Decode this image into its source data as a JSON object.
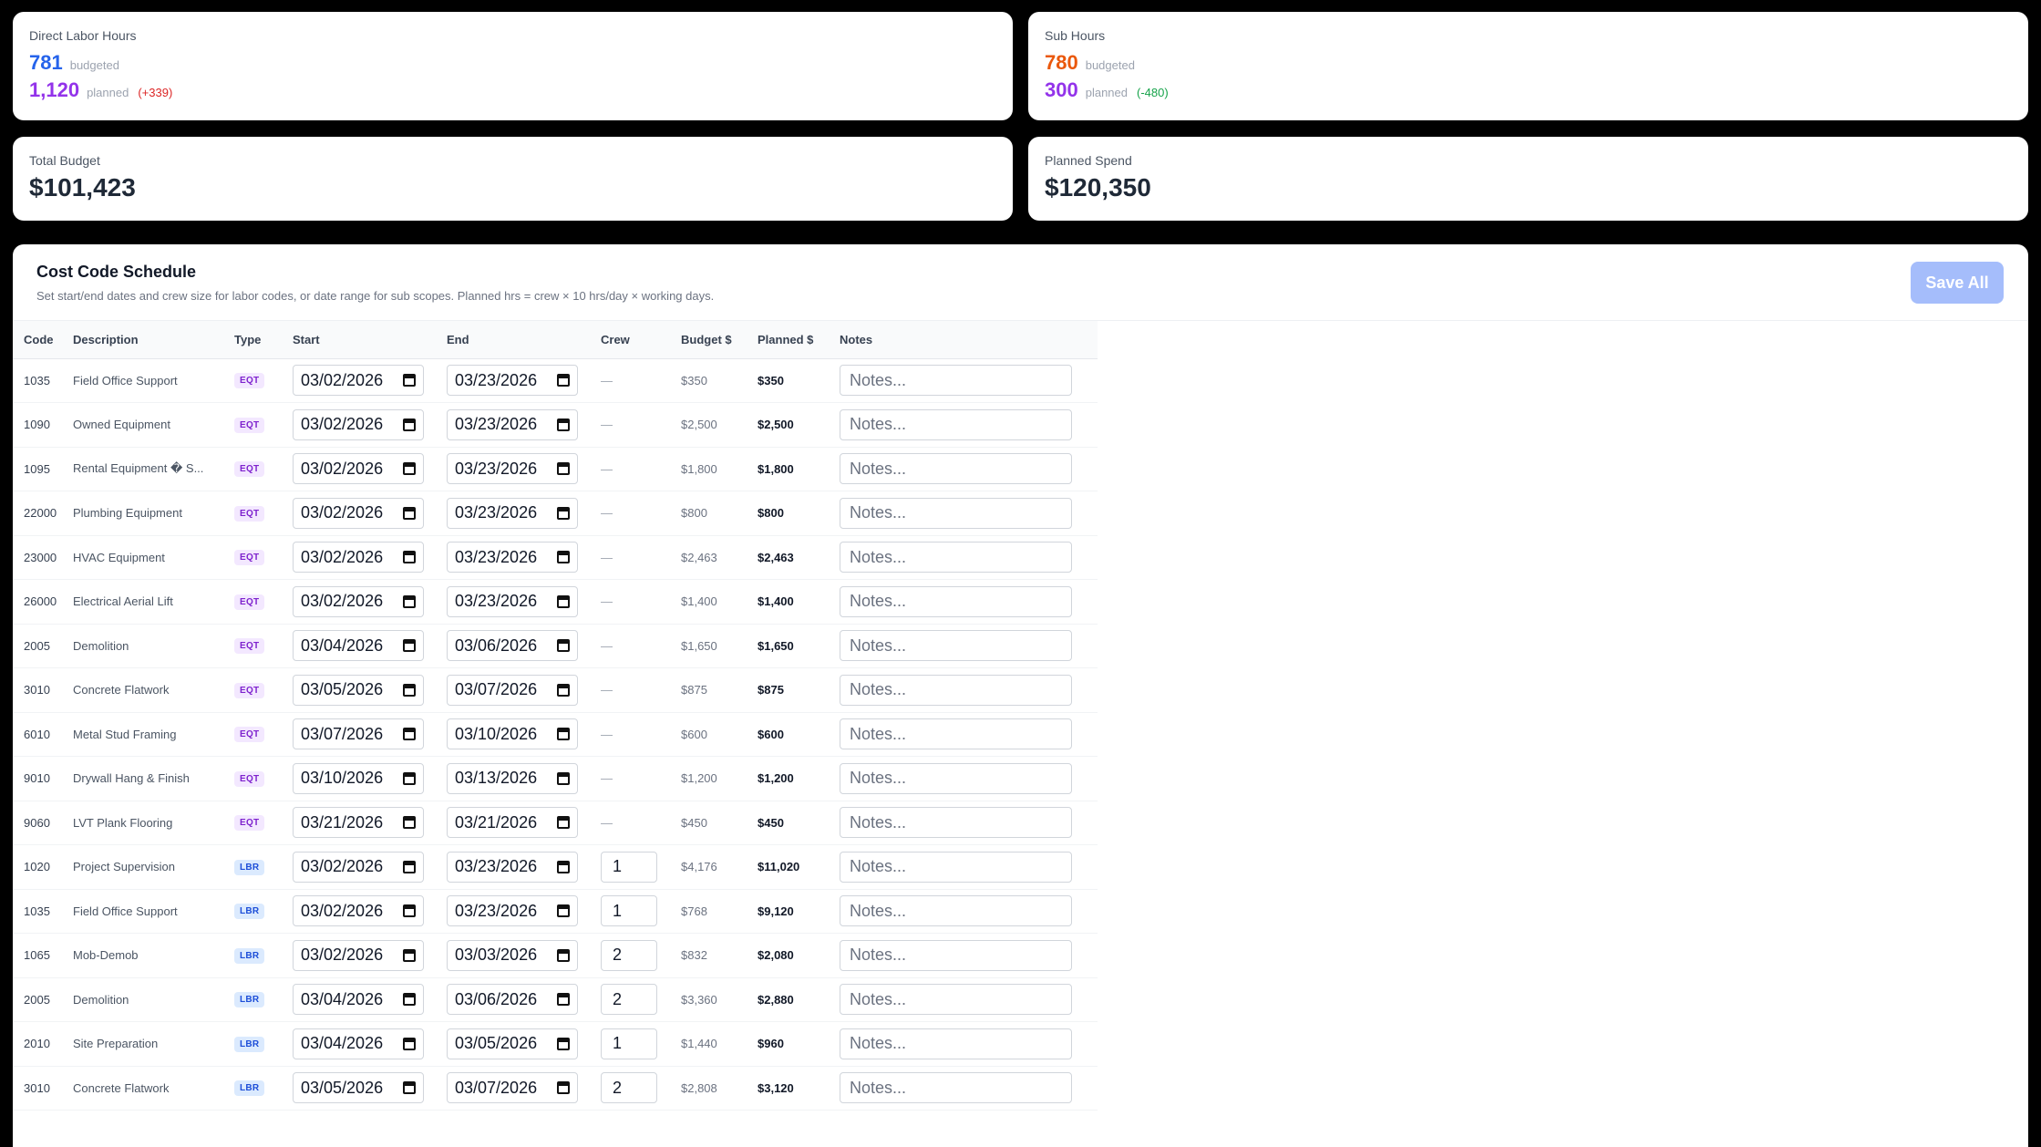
{
  "cards": {
    "labor": {
      "label": "Direct Labor Hours",
      "budgeted_value": "781",
      "budgeted_label": "budgeted",
      "planned_value": "1,120",
      "planned_label": "planned",
      "delta": "(+339)",
      "colors": {
        "budgeted": "#2563eb",
        "planned": "#9333ea",
        "delta": "#dc2626"
      }
    },
    "sub": {
      "label": "Sub Hours",
      "budgeted_value": "780",
      "budgeted_label": "budgeted",
      "planned_value": "300",
      "planned_label": "planned",
      "delta": "(-480)",
      "colors": {
        "budgeted": "#ea580c",
        "planned": "#9333ea",
        "delta": "#16a34a"
      }
    },
    "total_budget": {
      "label": "Total Budget",
      "value": "$101,423"
    },
    "planned_spend": {
      "label": "Planned Spend",
      "value": "$120,350"
    }
  },
  "schedule": {
    "title": "Cost Code Schedule",
    "subtitle": "Set start/end dates and crew size for labor codes, or date range for sub scopes. Planned hrs = crew × 10 hrs/day × working days.",
    "save_label": "Save All",
    "notes_placeholder": "Notes...",
    "columns": [
      "Code",
      "Description",
      "Type",
      "Start",
      "End",
      "Crew",
      "Budget $",
      "Planned $",
      "Notes"
    ],
    "rows": [
      {
        "code": "1035",
        "desc": "Field Office Support",
        "type": "EQT",
        "start": "03/02/2026",
        "end": "03/23/2026",
        "crew": "—",
        "budget": "$350",
        "planned": "$350"
      },
      {
        "code": "1090",
        "desc": "Owned Equipment",
        "type": "EQT",
        "start": "03/02/2026",
        "end": "03/23/2026",
        "crew": "—",
        "budget": "$2,500",
        "planned": "$2,500"
      },
      {
        "code": "1095",
        "desc": "Rental Equipment � S...",
        "type": "EQT",
        "start": "03/02/2026",
        "end": "03/23/2026",
        "crew": "—",
        "budget": "$1,800",
        "planned": "$1,800"
      },
      {
        "code": "22000",
        "desc": "Plumbing Equipment",
        "type": "EQT",
        "start": "03/02/2026",
        "end": "03/23/2026",
        "crew": "—",
        "budget": "$800",
        "planned": "$800"
      },
      {
        "code": "23000",
        "desc": "HVAC Equipment",
        "type": "EQT",
        "start": "03/02/2026",
        "end": "03/23/2026",
        "crew": "—",
        "budget": "$2,463",
        "planned": "$2,463"
      },
      {
        "code": "26000",
        "desc": "Electrical Aerial Lift",
        "type": "EQT",
        "start": "03/02/2026",
        "end": "03/23/2026",
        "crew": "—",
        "budget": "$1,400",
        "planned": "$1,400"
      },
      {
        "code": "2005",
        "desc": "Demolition",
        "type": "EQT",
        "start": "03/04/2026",
        "end": "03/06/2026",
        "crew": "—",
        "budget": "$1,650",
        "planned": "$1,650"
      },
      {
        "code": "3010",
        "desc": "Concrete Flatwork",
        "type": "EQT",
        "start": "03/05/2026",
        "end": "03/07/2026",
        "crew": "—",
        "budget": "$875",
        "planned": "$875"
      },
      {
        "code": "6010",
        "desc": "Metal Stud Framing",
        "type": "EQT",
        "start": "03/07/2026",
        "end": "03/10/2026",
        "crew": "—",
        "budget": "$600",
        "planned": "$600"
      },
      {
        "code": "9010",
        "desc": "Drywall Hang & Finish",
        "type": "EQT",
        "start": "03/10/2026",
        "end": "03/13/2026",
        "crew": "—",
        "budget": "$1,200",
        "planned": "$1,200"
      },
      {
        "code": "9060",
        "desc": "LVT Plank Flooring",
        "type": "EQT",
        "start": "03/21/2026",
        "end": "03/21/2026",
        "crew": "—",
        "budget": "$450",
        "planned": "$450"
      },
      {
        "code": "1020",
        "desc": "Project Supervision",
        "type": "LBR",
        "start": "03/02/2026",
        "end": "03/23/2026",
        "crew": "1",
        "budget": "$4,176",
        "planned": "$11,020"
      },
      {
        "code": "1035",
        "desc": "Field Office Support",
        "type": "LBR",
        "start": "03/02/2026",
        "end": "03/23/2026",
        "crew": "1",
        "budget": "$768",
        "planned": "$9,120"
      },
      {
        "code": "1065",
        "desc": "Mob-Demob",
        "type": "LBR",
        "start": "03/02/2026",
        "end": "03/03/2026",
        "crew": "2",
        "budget": "$832",
        "planned": "$2,080"
      },
      {
        "code": "2005",
        "desc": "Demolition",
        "type": "LBR",
        "start": "03/04/2026",
        "end": "03/06/2026",
        "crew": "2",
        "budget": "$3,360",
        "planned": "$2,880"
      },
      {
        "code": "2010",
        "desc": "Site Preparation",
        "type": "LBR",
        "start": "03/04/2026",
        "end": "03/05/2026",
        "crew": "1",
        "budget": "$1,440",
        "planned": "$960"
      },
      {
        "code": "3010",
        "desc": "Concrete Flatwork",
        "type": "LBR",
        "start": "03/05/2026",
        "end": "03/07/2026",
        "crew": "2",
        "budget": "$2,808",
        "planned": "$3,120"
      }
    ]
  }
}
